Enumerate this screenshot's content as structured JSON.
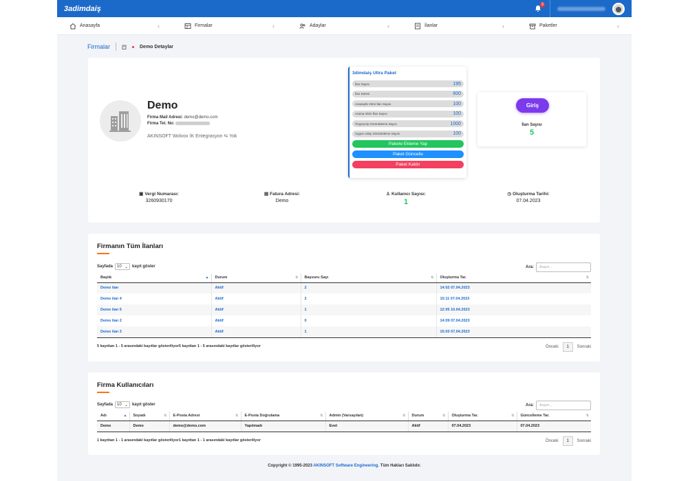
{
  "brand": {
    "logo": "3adimdaiş"
  },
  "header": {
    "notif_count": "3"
  },
  "nav": [
    {
      "label": "Anasayfa",
      "icon": "home-icon"
    },
    {
      "label": "Firmalar",
      "icon": "table-icon"
    },
    {
      "label": "Adaylar",
      "icon": "users-icon"
    },
    {
      "label": "İlanlar",
      "icon": "list-icon"
    },
    {
      "label": "Paketler",
      "icon": "box-icon"
    }
  ],
  "breadcrumb": {
    "root": "Firmalar",
    "current": "Demo Detaylar"
  },
  "company": {
    "name": "Demo",
    "mail_label": "Firma Mail Adresi:",
    "mail": "demo@demo.com",
    "phone_label": "Firma Tel. No:",
    "integration": "AKINSOFT Wolvox İK Entegrasyon",
    "integration_value": "Yok"
  },
  "package": {
    "title": "3dimdaiş Ultra Paket",
    "rows": [
      {
        "label": "İlan Sayısı",
        "value": "195"
      },
      {
        "label": "İlan Süresi",
        "value": "600"
      },
      {
        "label": "Anasayfa Vitrin İlan Sayısı",
        "value": "100"
      },
      {
        "label": "Arama Vitrin İlan Sayısı",
        "value": "100"
      },
      {
        "label": "Özgeçmiş Görüntüleme Sayısı",
        "value": "1000"
      },
      {
        "label": "Uygun Aday Görüntüleme Sayısı",
        "value": "100"
      }
    ],
    "btn_add": "Pakete Ekleme Yap",
    "btn_update": "Paket Güncelle",
    "btn_remove": "Paket Kaldır"
  },
  "login": {
    "label": "Giriş"
  },
  "ilan_box": {
    "label": "İlan Sayısı",
    "value": "5"
  },
  "stats": {
    "vergi": {
      "label": "Vergi Numarası:",
      "value": "3260930170"
    },
    "fatura": {
      "label": "Fatura Adresi:",
      "value": "Demo"
    },
    "kullanici": {
      "label": "Kullanıcı Sayısı:",
      "value": "1"
    },
    "tarih": {
      "label": "Oluşturma Tarihi:",
      "value": "07.04.2023"
    }
  },
  "listings": {
    "title": "Firmanın Tüm İlanları",
    "len_prefix": "Sayfada",
    "len_value": "10",
    "len_suffix": "kayıt göster",
    "search_label": "Ara:",
    "search_placeholder": "Arayın...",
    "headers": [
      "Başlık",
      "Durum",
      "Başvuru Sayı",
      "Oluşturma Tar."
    ],
    "rows": [
      [
        "Demo ilan",
        "Aktif",
        "2",
        "14:02 07.04.2023"
      ],
      [
        "Demo ilan 4",
        "Aktif",
        "2",
        "15:11 07.04.2023"
      ],
      [
        "Demo ilan 5",
        "Aktif",
        "1",
        "12:05 10.04.2023"
      ],
      [
        "Demo ilan 2",
        "Aktif",
        "0",
        "14:09 07.04.2023"
      ],
      [
        "Demo ilan 3",
        "Aktif",
        "1",
        "15:03 07.04.2023"
      ]
    ],
    "info": "5 kayıttan 1 - 5 arasındaki kayıtlar gösteriliyor5 kayıttan 1 - 5 arasındaki kayıtlar gösteriliyor",
    "prev": "Önceki",
    "page": "1",
    "next": "Sonraki"
  },
  "users": {
    "title": "Firma Kullanıcıları",
    "len_prefix": "Sayfada",
    "len_value": "10",
    "len_suffix": "kayıt göster",
    "search_label": "Ara:",
    "search_placeholder": "Arayın...",
    "headers": [
      "Adı",
      "Soyadı",
      "E-Posta Adresi",
      "E-Posta Doğrulama",
      "Admin (Varsayılan)",
      "Durum",
      "Oluşturma Tar.",
      "Güncelleme Tar."
    ],
    "rows": [
      [
        "Demo",
        "Demo",
        "demo@demo.com",
        "Yapılmadı",
        "Evet",
        "Aktif",
        "07.04.2023",
        "07.04.2023"
      ]
    ],
    "info": "1 kayıttan 1 - 1 arasındaki kayıtlar gösteriliyor1 kayıttan 1 - 1 arasındaki kayıtlar gösteriliyor",
    "prev": "Önceki",
    "page": "1",
    "next": "Sonraki"
  },
  "footer": {
    "pre": "Copyright © 1995-2023",
    "brand": "AKINSOFT Software Engineering.",
    "post": "Tüm Hakları Saklıdır."
  }
}
